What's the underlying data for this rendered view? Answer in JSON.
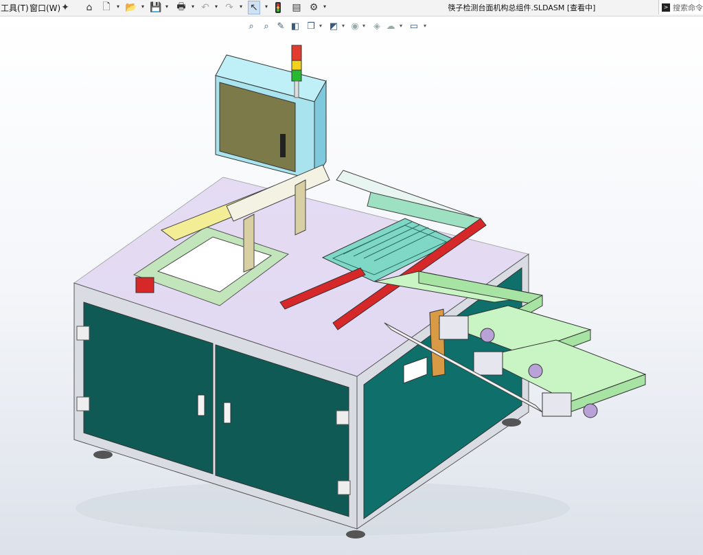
{
  "menu": {
    "tools": "工具(T)",
    "window": "窗口(W)"
  },
  "window_title": "筷子检测台面机构总组件.SLDASM [查看中]",
  "search": {
    "placeholder": "搜索命令"
  },
  "toolbar_icons": [
    "pin-icon",
    "home-icon",
    "new-document-icon",
    "open-document-icon",
    "save-icon",
    "print-icon",
    "undo-icon",
    "redo-icon",
    "select-arrow-icon",
    "traffic-light-icon",
    "file-properties-icon",
    "options-gear-icon"
  ],
  "heads_up_icons": [
    "zoom-to-fit-icon",
    "zoom-area-icon",
    "previous-view-icon",
    "section-view-icon",
    "view-orientation-icon",
    "display-style-icon",
    "hide-show-icon",
    "edit-appearance-icon",
    "apply-scene-icon",
    "view-settings-icon"
  ],
  "colors": {
    "cabinet_panel": "#0f5a55",
    "frame": "#d9dde3",
    "conveyor_belt": "#c9f5c4",
    "red_rail": "#d62828",
    "control_box": "#a8e3ee",
    "tray": "#b7ecd3"
  }
}
